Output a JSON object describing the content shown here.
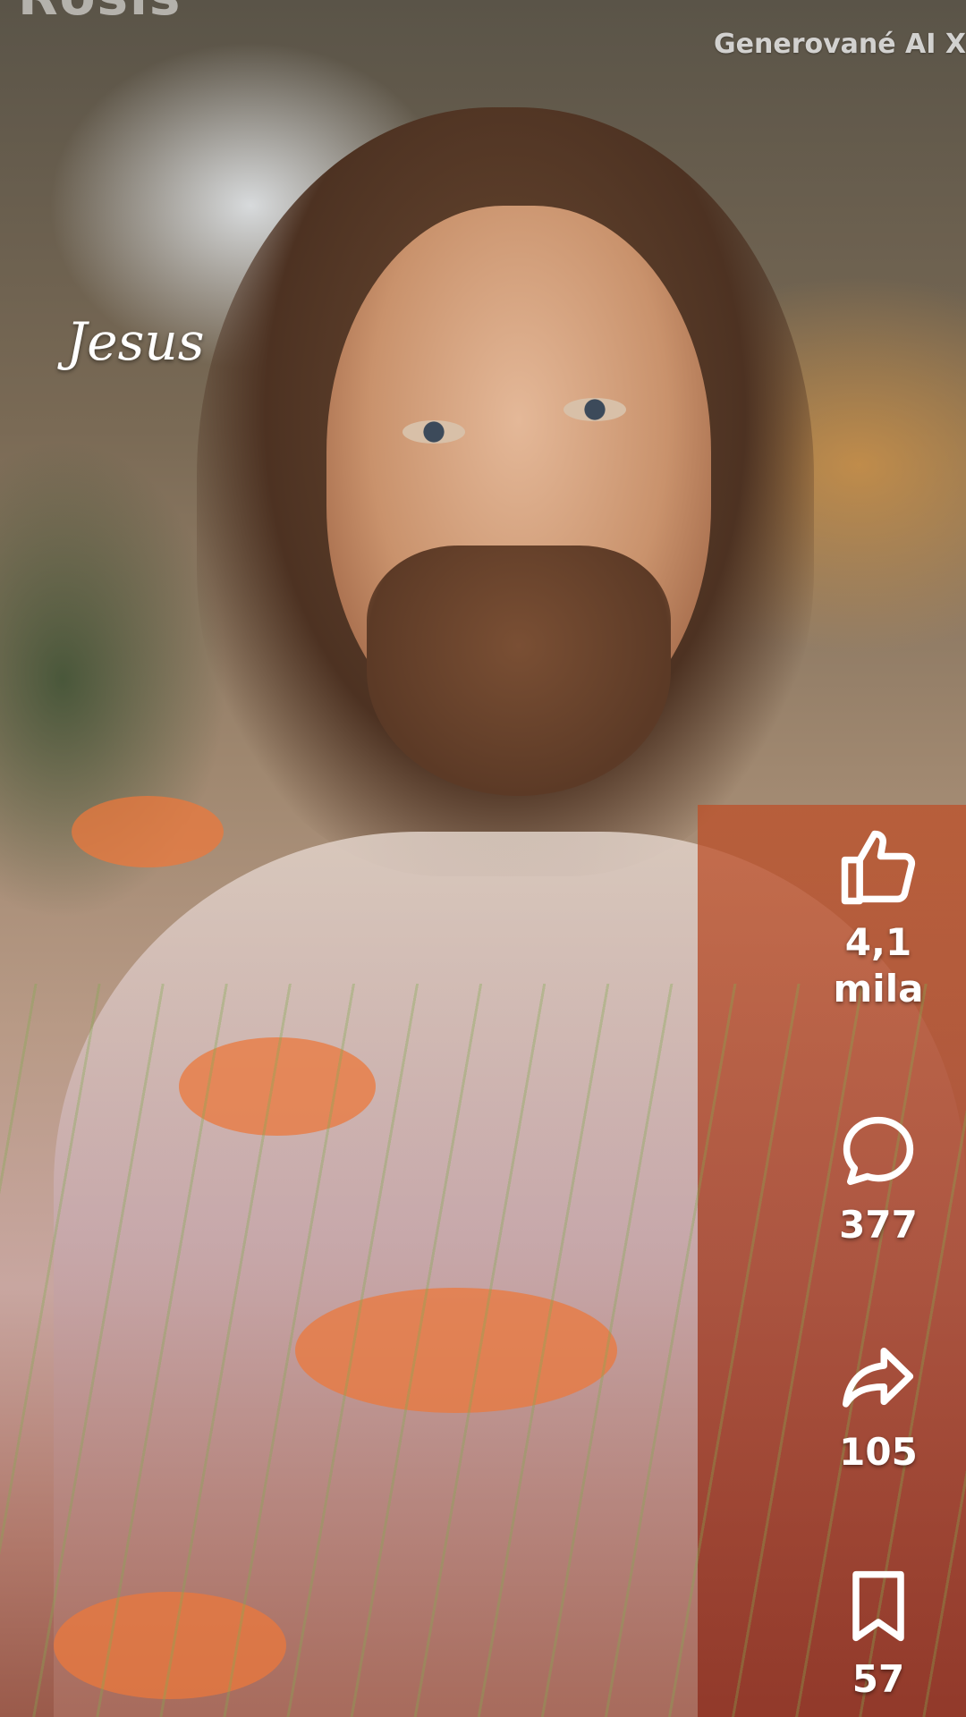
{
  "watermark": {
    "text": "Rosis"
  },
  "overlay": {
    "ai_label": "Generované AI  X"
  },
  "caption": {
    "text": "Jesus"
  },
  "actions": {
    "like": {
      "icon": "thumbs-up-icon",
      "count": "4,1 mila"
    },
    "comment": {
      "icon": "comment-icon",
      "count": "377"
    },
    "share": {
      "icon": "share-icon",
      "count": "105"
    },
    "save": {
      "icon": "bookmark-icon",
      "count": "57"
    }
  },
  "colors": {
    "icon": "#ffffff"
  }
}
